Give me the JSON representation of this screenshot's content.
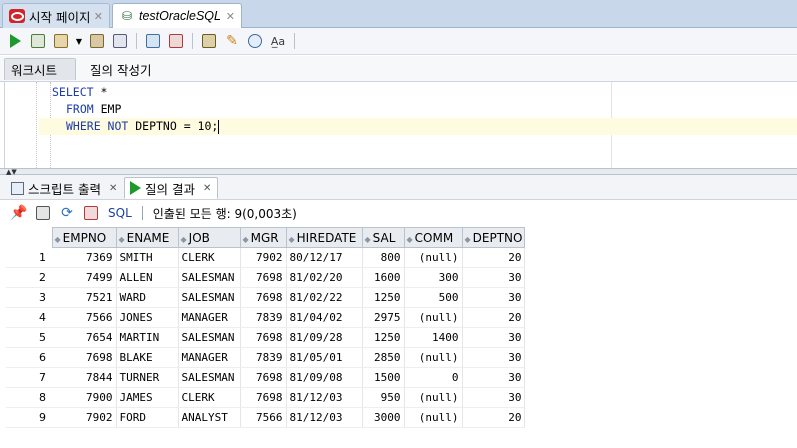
{
  "doc_tabs": [
    {
      "label": "시작 페이지"
    },
    {
      "label": "testOracleSQL"
    }
  ],
  "worksheet_tabs": [
    {
      "label": "워크시트"
    },
    {
      "label": "질의 작성기"
    }
  ],
  "editor": {
    "lines": [
      {
        "kw1": "SELECT",
        "rest": " *"
      },
      {
        "kw1": "FROM",
        "rest": " EMP"
      },
      {
        "kw1": "WHERE NOT",
        "rest": " DEPTNO = 10;"
      }
    ]
  },
  "result_tabs": [
    {
      "label": "스크립트 출력"
    },
    {
      "label": "질의 결과"
    }
  ],
  "result_toolbar": {
    "sql_label": "SQL",
    "status": "인출된 모든 행: 9(0,003초)"
  },
  "grid": {
    "columns": [
      "EMPNO",
      "ENAME",
      "JOB",
      "MGR",
      "HIREDATE",
      "SAL",
      "COMM",
      "DEPTNO"
    ],
    "rows": [
      {
        "n": "1",
        "cells": [
          "7369",
          "SMITH",
          "CLERK",
          "7902",
          "80/12/17",
          "800",
          "(null)",
          "20"
        ]
      },
      {
        "n": "2",
        "cells": [
          "7499",
          "ALLEN",
          "SALESMAN",
          "7698",
          "81/02/20",
          "1600",
          "300",
          "30"
        ]
      },
      {
        "n": "3",
        "cells": [
          "7521",
          "WARD",
          "SALESMAN",
          "7698",
          "81/02/22",
          "1250",
          "500",
          "30"
        ]
      },
      {
        "n": "4",
        "cells": [
          "7566",
          "JONES",
          "MANAGER",
          "7839",
          "81/04/02",
          "2975",
          "(null)",
          "20"
        ]
      },
      {
        "n": "5",
        "cells": [
          "7654",
          "MARTIN",
          "SALESMAN",
          "7698",
          "81/09/28",
          "1250",
          "1400",
          "30"
        ]
      },
      {
        "n": "6",
        "cells": [
          "7698",
          "BLAKE",
          "MANAGER",
          "7839",
          "81/05/01",
          "2850",
          "(null)",
          "30"
        ]
      },
      {
        "n": "7",
        "cells": [
          "7844",
          "TURNER",
          "SALESMAN",
          "7698",
          "81/09/08",
          "1500",
          "0",
          "30"
        ]
      },
      {
        "n": "8",
        "cells": [
          "7900",
          "JAMES",
          "CLERK",
          "7698",
          "81/12/03",
          "950",
          "(null)",
          "30"
        ]
      },
      {
        "n": "9",
        "cells": [
          "7902",
          "FORD",
          "ANALYST",
          "7566",
          "81/12/03",
          "3000",
          "(null)",
          "20"
        ]
      }
    ]
  },
  "colors": {
    "keyword": "#1d3ea8",
    "run_green": "#1e9a2c",
    "current_line": "#fffbe0"
  }
}
